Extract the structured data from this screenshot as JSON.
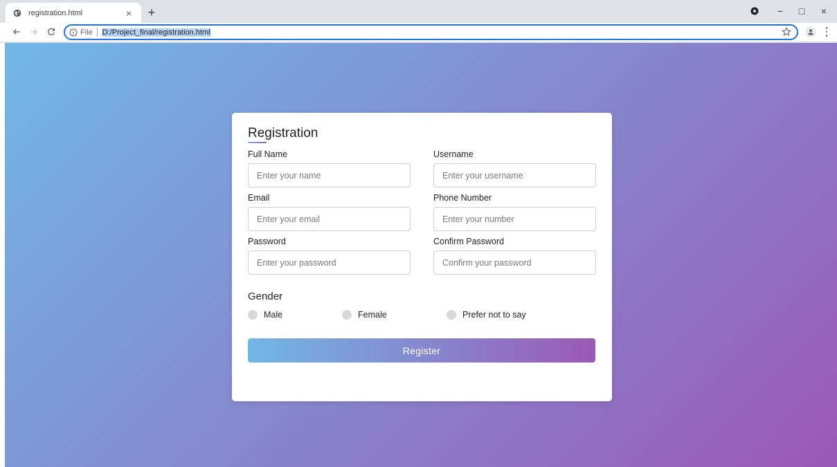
{
  "browser": {
    "tab_title": "registration.html",
    "tab_close": "×",
    "new_tab": "+",
    "scheme": "File",
    "url": "D:/Project_final/registration.html",
    "window_minimize": "−",
    "window_restore": "□",
    "window_close": "×"
  },
  "form": {
    "title": "Registration",
    "fields": [
      {
        "label": "Full Name",
        "placeholder": "Enter your name"
      },
      {
        "label": "Username",
        "placeholder": "Enter your username"
      },
      {
        "label": "Email",
        "placeholder": "Enter your email"
      },
      {
        "label": "Phone Number",
        "placeholder": "Enter your number"
      },
      {
        "label": "Password",
        "placeholder": "Enter your password"
      },
      {
        "label": "Confirm Password",
        "placeholder": "Confirm your password"
      }
    ],
    "gender": {
      "title": "Gender",
      "options": [
        "Male",
        "Female",
        "Prefer not to say"
      ]
    },
    "submit_label": "Register"
  },
  "colors": {
    "gradient_start": "#71b7e6",
    "gradient_end": "#9b59b6",
    "omnibox_focus": "#1a73e8"
  },
  "icons": {
    "tab_favicon": "globe-icon",
    "back": "arrow-left-icon",
    "forward": "arrow-right-icon",
    "reload": "reload-icon",
    "site_info": "info-icon",
    "bookmark": "star-icon",
    "profile": "person-icon",
    "menu": "kebab-menu-icon",
    "extension": "circle-icon"
  }
}
